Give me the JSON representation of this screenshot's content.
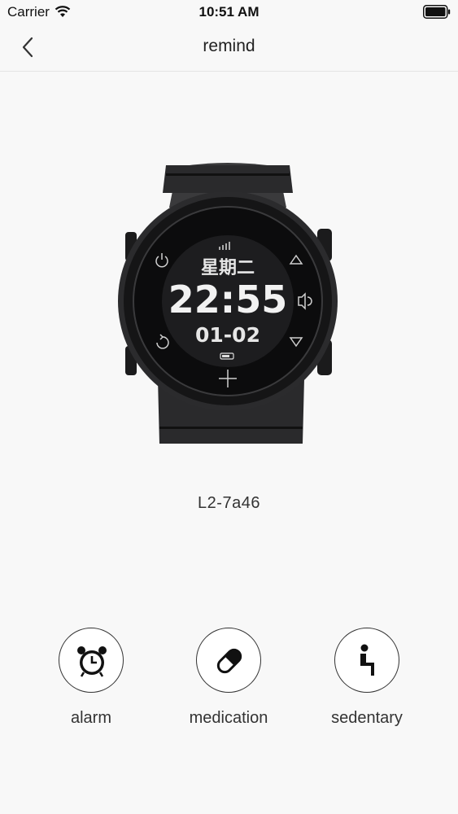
{
  "status_bar": {
    "carrier": "Carrier",
    "time": "10:51 AM"
  },
  "nav": {
    "title": "remind",
    "back_icon": "chevron-left-icon"
  },
  "watch": {
    "weekday": "星期二",
    "time": "22:55",
    "date": "01-02"
  },
  "device_name": "L2-7a46",
  "reminders": [
    {
      "label": "alarm",
      "icon": "alarm-clock-icon"
    },
    {
      "label": "medication",
      "icon": "pill-icon"
    },
    {
      "label": "sedentary",
      "icon": "sitting-person-icon"
    }
  ]
}
